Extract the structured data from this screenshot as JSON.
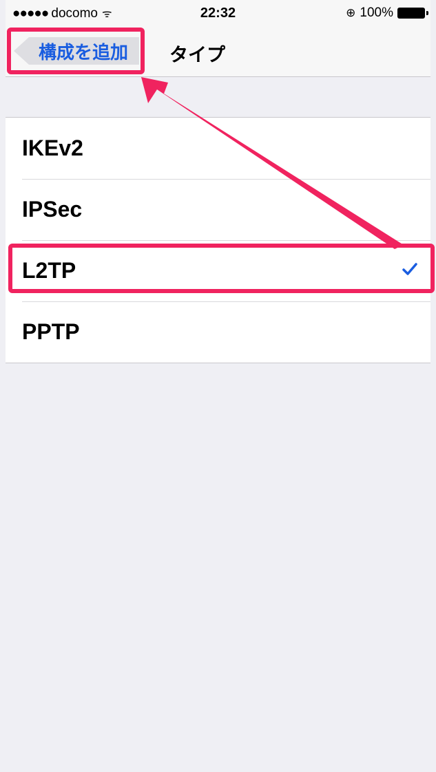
{
  "status_bar": {
    "signal_dots": "●●●●●",
    "carrier": "docomo",
    "wifi_glyph": "ᯤ",
    "time": "22:32",
    "lock_glyph": "⊕",
    "battery_percent": "100%"
  },
  "nav": {
    "back_label": "構成を追加",
    "title": "タイプ"
  },
  "vpn_types": [
    {
      "label": "IKEv2",
      "selected": false
    },
    {
      "label": "IPSec",
      "selected": false
    },
    {
      "label": "L2TP",
      "selected": true
    },
    {
      "label": "PPTP",
      "selected": false
    }
  ],
  "colors": {
    "accent": "#1a5de0",
    "highlight": "#f0235f",
    "background": "#efeff4"
  },
  "icons": {
    "back": "chevron-left-icon",
    "check": "checkmark-icon",
    "wifi": "wifi-icon",
    "battery": "battery-icon",
    "rotation_lock": "rotation-lock-icon"
  }
}
